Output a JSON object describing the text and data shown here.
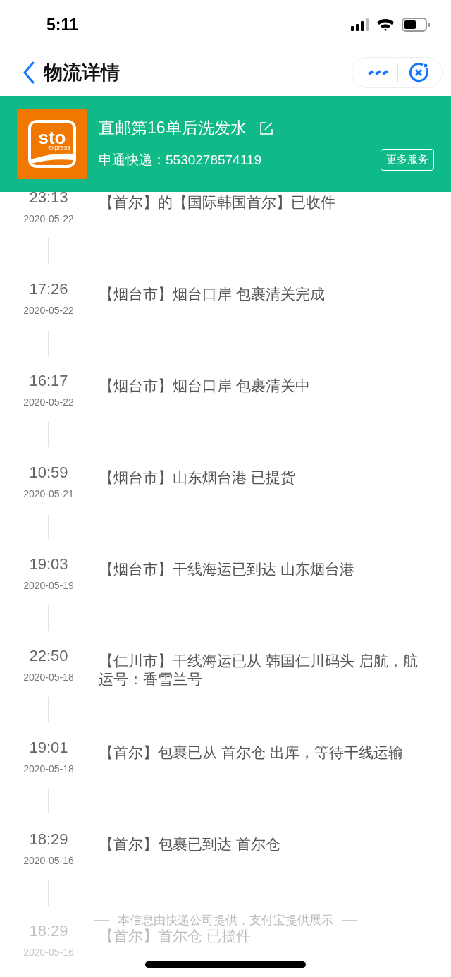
{
  "status_bar": {
    "time": "5:11"
  },
  "nav": {
    "title": "物流详情"
  },
  "package": {
    "logo_text": "sto",
    "logo_subtext": "express",
    "name": "直邮第16单后洗发水",
    "carrier_label": "申通快递：",
    "tracking_number": "5530278574119",
    "more_button": "更多服务"
  },
  "events": [
    {
      "time": "23:13",
      "date": "2020-05-22",
      "text": "【首尔】的【国际韩国首尔】已收件",
      "faded": false
    },
    {
      "time": "17:26",
      "date": "2020-05-22",
      "text": "【烟台市】烟台口岸 包裹清关完成",
      "faded": false
    },
    {
      "time": "16:17",
      "date": "2020-05-22",
      "text": "【烟台市】烟台口岸 包裹清关中",
      "faded": false
    },
    {
      "time": "10:59",
      "date": "2020-05-21",
      "text": "【烟台市】山东烟台港 已提货",
      "faded": false
    },
    {
      "time": "19:03",
      "date": "2020-05-19",
      "text": "【烟台市】干线海运已到达 山东烟台港",
      "faded": false
    },
    {
      "time": "22:50",
      "date": "2020-05-18",
      "text": "【仁川市】干线海运已从 韩国仁川码头 启航，航运号：香雪兰号",
      "faded": false
    },
    {
      "time": "19:01",
      "date": "2020-05-18",
      "text": "【首尔】包裹已从 首尔仓 出库，等待干线运输",
      "faded": false
    },
    {
      "time": "18:29",
      "date": "2020-05-16",
      "text": "【首尔】包裹已到达 首尔仓",
      "faded": false
    },
    {
      "time": "18:29",
      "date": "2020-05-16",
      "text": "【首尔】首尔仓 已揽件",
      "faded": true
    }
  ],
  "footer_note": "本信息由快递公司提供，支付宝提供展示"
}
